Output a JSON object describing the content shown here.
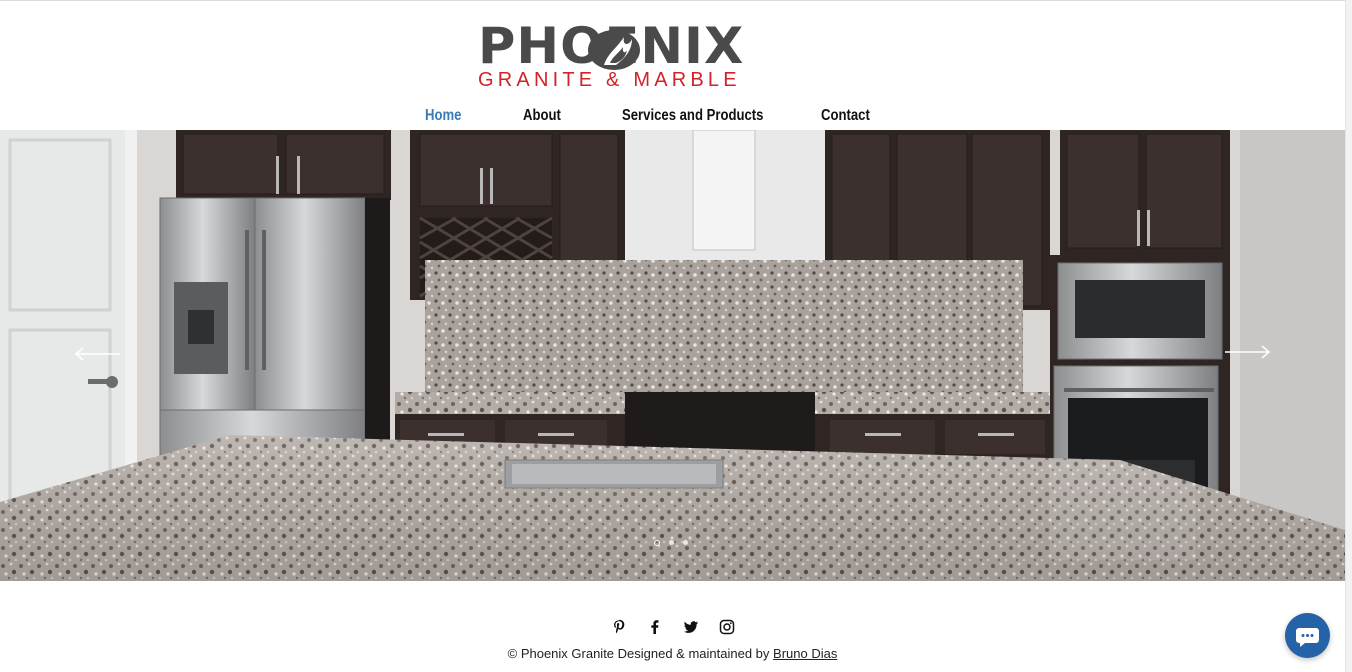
{
  "brand": {
    "name_line1": "PHOENIX",
    "name_line2": "GRANITE & MARBLE",
    "primary_color": "#4a4a4a",
    "accent_color": "#d1232a"
  },
  "nav": {
    "items": [
      {
        "label": "Home",
        "active": true
      },
      {
        "label": "About",
        "active": false
      },
      {
        "label": "Services and Products",
        "active": false
      },
      {
        "label": "Contact",
        "active": false
      }
    ],
    "active_color": "#3a7ab7"
  },
  "slideshow": {
    "image_subject": "kitchen-with-granite-countertops",
    "prev_icon": "arrow-left-icon",
    "next_icon": "arrow-right-icon",
    "slide_count": 3,
    "current_slide": 1
  },
  "social": {
    "icons": [
      "pinterest-icon",
      "facebook-icon",
      "twitter-icon",
      "instagram-icon"
    ]
  },
  "footer": {
    "text": "© Phoenix Granite Designed & maintained by",
    "link_label": "Bruno Dias"
  },
  "chat": {
    "icon": "chat-bubble-icon",
    "color": "#2463a8"
  }
}
